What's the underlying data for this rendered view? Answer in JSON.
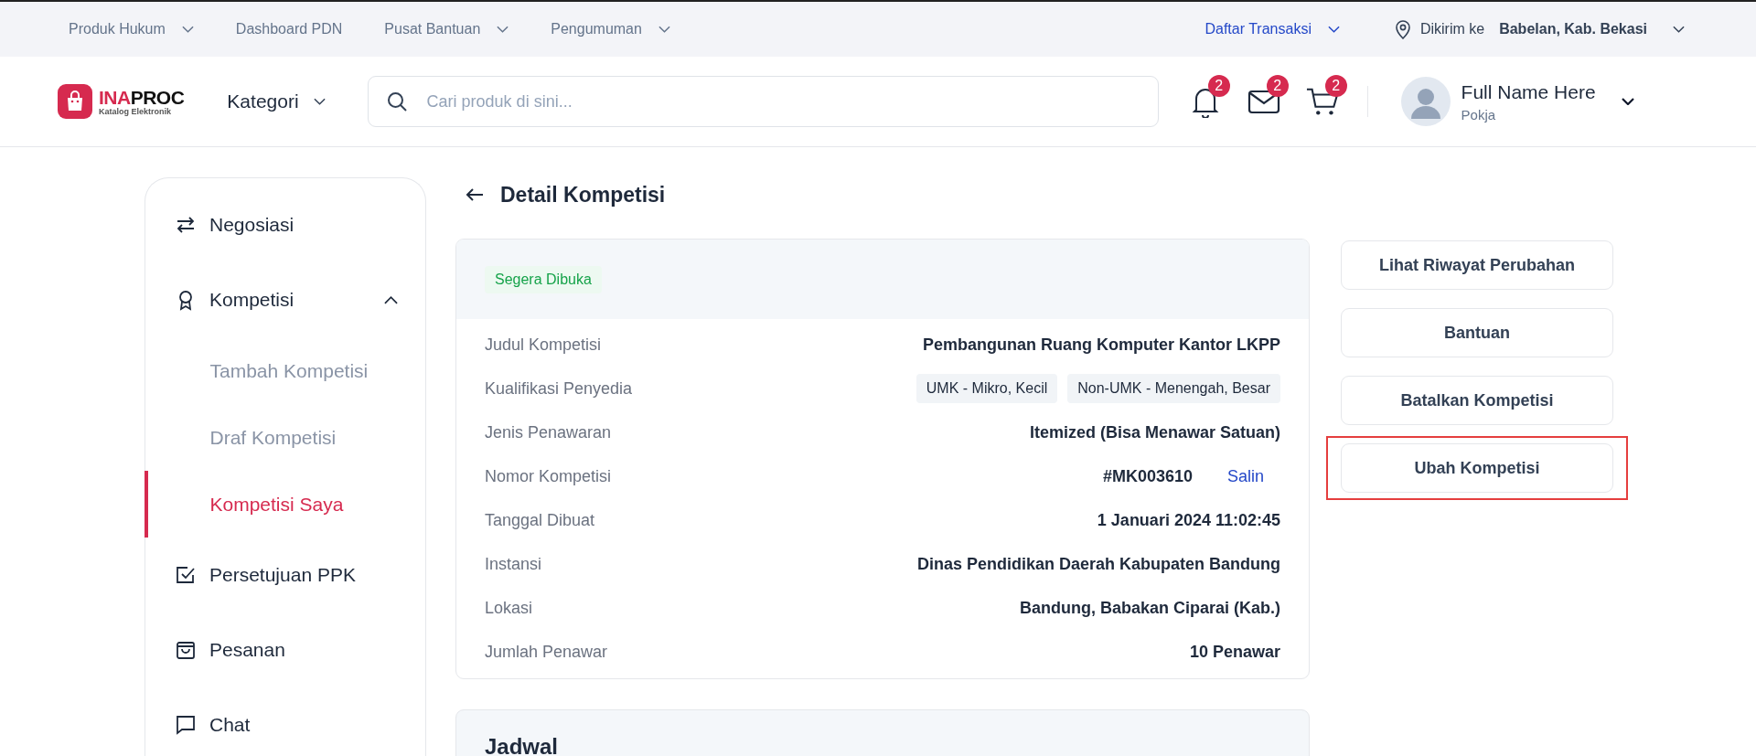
{
  "top_bar": {
    "links": [
      {
        "label": "Produk Hukum",
        "dropdown": true
      },
      {
        "label": "Dashboard PDN",
        "dropdown": false
      },
      {
        "label": "Pusat Bantuan",
        "dropdown": true
      },
      {
        "label": "Pengumuman",
        "dropdown": true
      }
    ],
    "transactions": {
      "label": "Daftar Transaksi"
    },
    "delivery": {
      "prefix": "Dikirim ke",
      "location": "Babelan, Kab. Bekasi"
    }
  },
  "header": {
    "logo": {
      "prefix": "INA",
      "suffix": "PROC",
      "subtitle": "Katalog Elektronik"
    },
    "category": "Kategori",
    "search": {
      "placeholder": "Cari produk di sini..."
    },
    "icons": [
      {
        "kind": "bell",
        "badge": "2"
      },
      {
        "kind": "mail",
        "badge": "2"
      },
      {
        "kind": "cart",
        "badge": "2"
      }
    ],
    "user": {
      "name": "Full Name Here",
      "role": "Pokja"
    }
  },
  "sidebar": {
    "items": [
      {
        "label": "Negosiasi",
        "kind": "swap",
        "selected": false
      },
      {
        "label": "Kompetisi",
        "kind": "award",
        "selected": false,
        "expanded": true,
        "children": [
          {
            "label": "Tambah Kompetisi",
            "selected": false
          },
          {
            "label": "Draf Kompetisi",
            "selected": false
          },
          {
            "label": "Kompetisi Saya",
            "selected": true
          }
        ]
      },
      {
        "label": "Persetujuan PPK",
        "kind": "check",
        "selected": false
      },
      {
        "label": "Pesanan",
        "kind": "bag",
        "selected": false
      },
      {
        "label": "Chat",
        "kind": "chat",
        "selected": false
      }
    ]
  },
  "page_title": "Detail Kompetisi",
  "status_badge": "Segera Dibuka",
  "details": [
    {
      "kind": "text",
      "label": "Judul Kompetisi",
      "value": "Pembangunan Ruang Komputer Kantor LKPP"
    },
    {
      "kind": "tags",
      "label": "Kualifikasi Penyedia",
      "tags": [
        "UMK - Mikro, Kecil",
        "Non-UMK - Menengah, Besar"
      ]
    },
    {
      "kind": "text",
      "label": "Jenis Penawaran",
      "value": "Itemized (Bisa Menawar Satuan)"
    },
    {
      "kind": "copy",
      "label": "Nomor Kompetisi",
      "value": "#MK003610",
      "action": "Salin"
    },
    {
      "kind": "text",
      "label": "Tanggal Dibuat",
      "value": "1 Januari 2024 11:02:45"
    },
    {
      "kind": "text",
      "label": "Instansi",
      "value": "Dinas Pendidikan Daerah Kabupaten Bandung"
    },
    {
      "kind": "text",
      "label": "Lokasi",
      "value": "Bandung, Babakan Ciparai (Kab.)"
    },
    {
      "kind": "text",
      "label": "Jumlah Penawar",
      "value": "10 Penawar"
    }
  ],
  "actions": [
    {
      "label": "Lihat Riwayat Perubahan",
      "highlighted": false
    },
    {
      "label": "Bantuan",
      "highlighted": false
    },
    {
      "label": "Batalkan Kompetisi",
      "highlighted": false
    },
    {
      "label": "Ubah Kompetisi",
      "highlighted": true
    }
  ],
  "next_section": {
    "title": "Jadwal"
  }
}
